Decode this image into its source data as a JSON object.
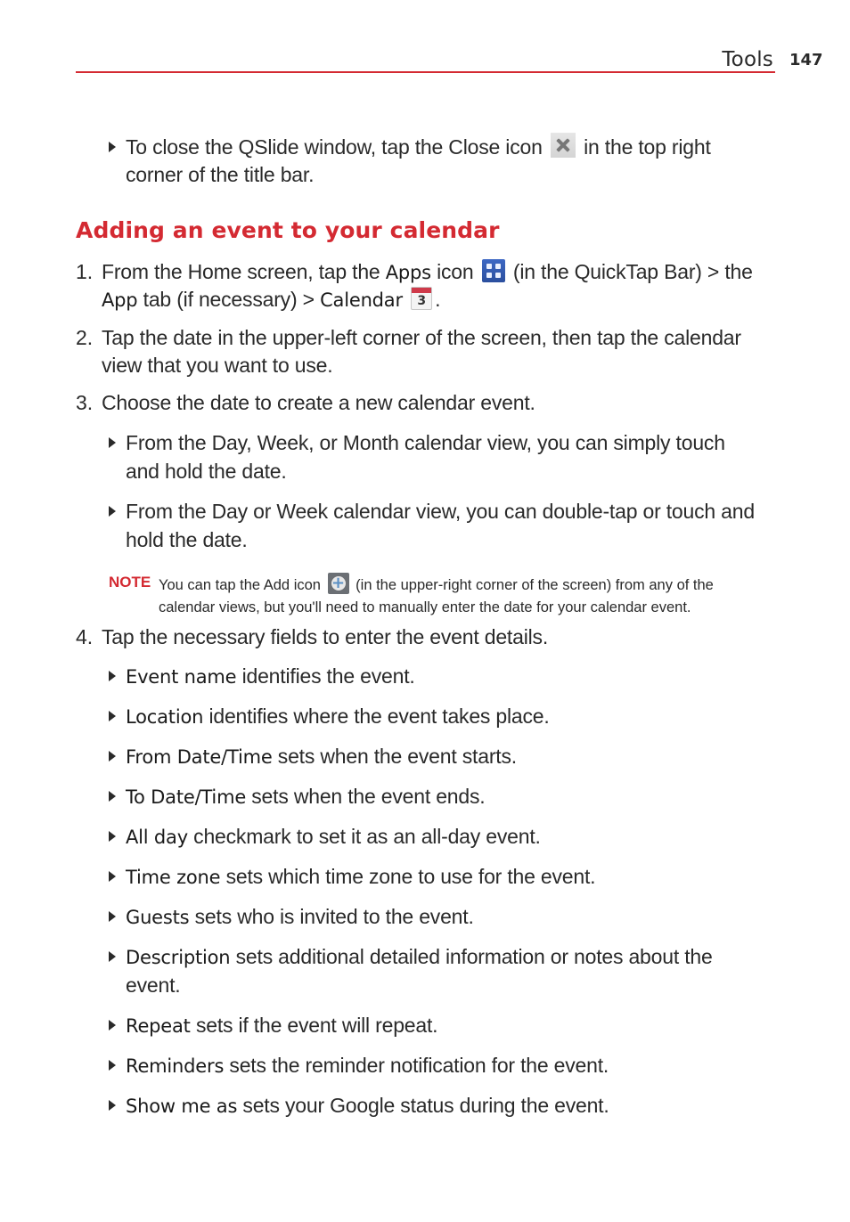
{
  "header": {
    "section": "Tools",
    "page_number": "147",
    "accent_color": "#d42a32"
  },
  "intro_bullet": {
    "line1_before": "To close the QSlide window, tap the Close icon",
    "line1_after": "in the top right",
    "line2": "corner of the title bar.",
    "icon": "close-icon"
  },
  "heading": "Adding an event to your calendar",
  "steps": [
    {
      "number": "1.",
      "line1_a": "From the Home screen, tap the",
      "line1_term": "Apps",
      "line1_b": "icon",
      "line1_c": "(in the QuickTap Bar) > the",
      "line2_term1": "App",
      "line2_a": "tab (if necessary) >",
      "line2_term2": "Calendar",
      "line2_end": ".",
      "icons": [
        "apps-grid-icon",
        "calendar-icon"
      ],
      "calendar_icon_number": "3"
    },
    {
      "number": "2.",
      "line1": "Tap the date in the upper-left corner of the screen, then tap the calendar",
      "line2": "view that you want to use."
    },
    {
      "number": "3.",
      "line1": "Choose the date to create a new calendar event.",
      "bullets": [
        {
          "line1": "From the Day, Week, or Month calendar view, you can simply touch",
          "line2": "and hold the date."
        },
        {
          "line1": "From the Day or Week calendar view, you can double-tap or touch and",
          "line2": "hold the date."
        }
      ]
    },
    {
      "number": "4.",
      "line1": "Tap the necessary fields to enter the event details.",
      "bullets": [
        {
          "term": "Event name",
          "text": "identifies the event."
        },
        {
          "term": "Location",
          "text": "identifies where the event takes place."
        },
        {
          "term": "From Date/Time",
          "text": "sets when the event starts."
        },
        {
          "term": "To Date/Time",
          "text": "sets when the event ends."
        },
        {
          "term": "All day",
          "text": "checkmark to set it as an all-day event."
        },
        {
          "term": "Time zone",
          "text": "sets which time zone to use for the event."
        },
        {
          "term": "Guests",
          "text": "sets who is invited to the event."
        },
        {
          "term": "Description",
          "text": "sets additional detailed information or notes about the",
          "line2": "event."
        },
        {
          "term": "Repeat",
          "text": "sets if the event will repeat."
        },
        {
          "term": "Reminders",
          "text": "sets the reminder notification for the event."
        },
        {
          "term": "Show me as",
          "text": "sets your Google status during the event."
        }
      ]
    }
  ],
  "note": {
    "label": "NOTE",
    "line1_before": "You can tap the Add icon",
    "line1_after": "(in the upper-right corner of the screen) from any of the",
    "line2": "calendar views, but you'll need to manually enter the date for your calendar event.",
    "icon": "add-icon"
  }
}
